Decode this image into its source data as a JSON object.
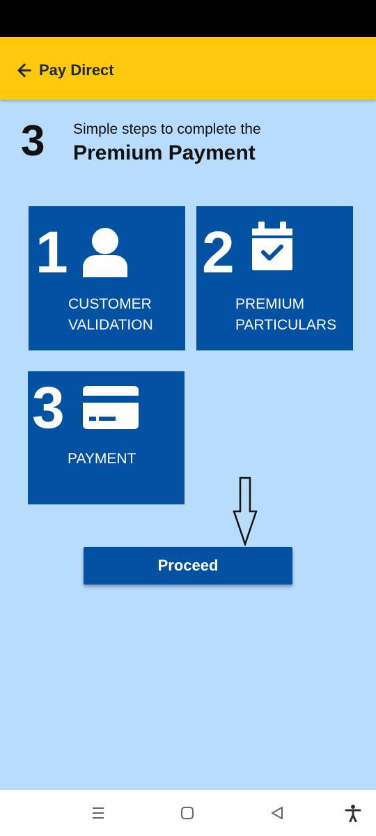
{
  "header": {
    "back_icon": "arrow-left-icon",
    "title": "Pay Direct",
    "accent_color": "#fec80b"
  },
  "intro": {
    "count": "3",
    "subtitle": "Simple steps to complete the",
    "title": "Premium Payment"
  },
  "steps": [
    {
      "number": "1",
      "icon": "user-icon",
      "line1": "CUSTOMER",
      "line2": "VALIDATION"
    },
    {
      "number": "2",
      "icon": "calendar-check-icon",
      "line1": "PREMIUM",
      "line2": "PARTICULARS"
    },
    {
      "number": "3",
      "icon": "credit-card-icon",
      "line1": "PAYMENT",
      "line2": ""
    }
  ],
  "tile_color": "#0251a3",
  "background_color": "#b8dcfb",
  "annotation_icon": "down-arrow-icon",
  "proceed_label": "Proceed",
  "nav": {
    "recents_icon": "recents-icon",
    "home_icon": "home-icon",
    "back_icon": "back-triangle-icon",
    "accessibility_icon": "accessibility-icon"
  }
}
